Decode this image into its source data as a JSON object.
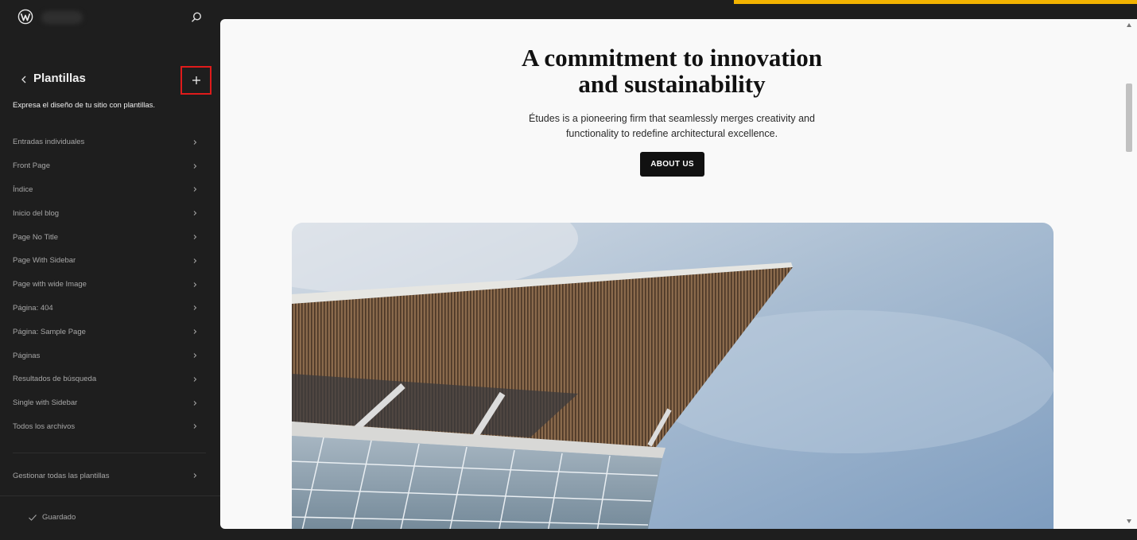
{
  "sidebar": {
    "logo_icon": "wordpress-logo-icon",
    "search_icon": "search-icon",
    "back_icon": "chevron-left-icon",
    "title": "Plantillas",
    "add_icon": "plus-icon",
    "description": "Expresa el diseño de tu sitio con plantillas.",
    "items": [
      {
        "label": "Entradas individuales"
      },
      {
        "label": "Front Page"
      },
      {
        "label": "Índice"
      },
      {
        "label": "Inicio del blog"
      },
      {
        "label": "Page No Title"
      },
      {
        "label": "Page With Sidebar"
      },
      {
        "label": "Page with wide Image"
      },
      {
        "label": "Página: 404"
      },
      {
        "label": "Página: Sample Page"
      },
      {
        "label": "Páginas"
      },
      {
        "label": "Resultados de búsqueda"
      },
      {
        "label": "Single with Sidebar"
      },
      {
        "label": "Todos los archivos"
      }
    ],
    "manage_label": "Gestionar todas las plantillas",
    "saved_label": "Guardado",
    "add_highlight_color": "#e01b1b"
  },
  "canvas": {
    "title_line1": "A commitment to innovation",
    "title_line2": "and sustainability",
    "text_line1": "Études is a pioneering firm that seamlessly merges creativity and",
    "text_line2": "functionality to redefine architectural excellence.",
    "button_label": "ABOUT US"
  },
  "colors": {
    "sidebar_bg": "#1e1e1e",
    "accent_bar": "#f3b300",
    "button_bg": "#111111"
  }
}
